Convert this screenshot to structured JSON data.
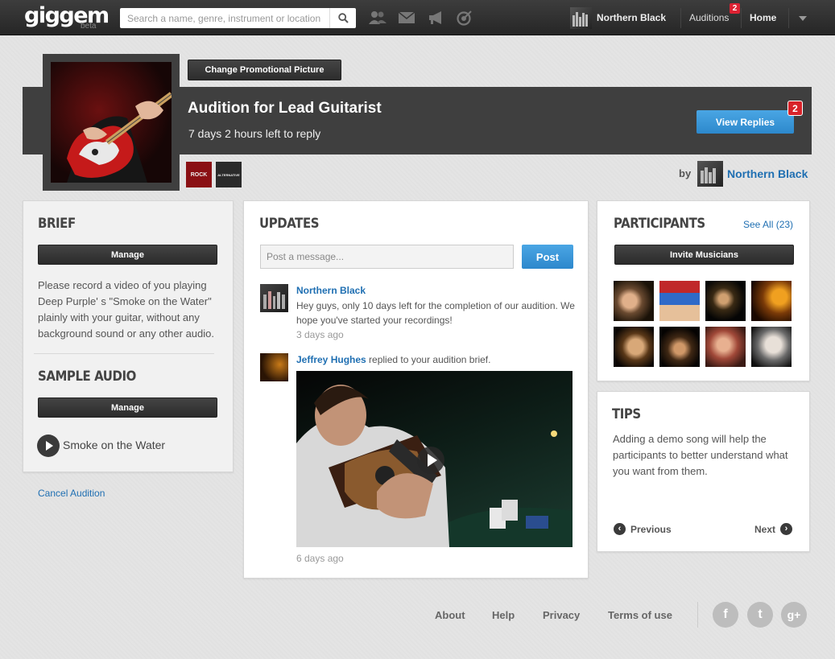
{
  "topbar": {
    "logo": "giggem",
    "logo_tag": "beta",
    "search_placeholder": "Search a name, genre, instrument or location",
    "nav_icons": [
      "people-icon",
      "mail-icon",
      "megaphone-icon",
      "target-icon"
    ],
    "user_name": "Northern Black",
    "auditions_label": "Auditions",
    "auditions_badge": "2",
    "home_label": "Home"
  },
  "header": {
    "change_picture_label": "Change Promotional Picture",
    "title": "Audition for Lead Guitarist",
    "time_left": "7 days 2 hours left to reply",
    "view_replies_label": "View Replies",
    "replies_badge": "2",
    "genres": [
      {
        "label": "ROCK",
        "color": "#8a1014"
      },
      {
        "label": "ALTERNATIVE",
        "color": "#2a2a2a"
      }
    ],
    "by_label": "by",
    "owner_name": "Northern Black"
  },
  "brief": {
    "heading": "BRIEF",
    "manage_label": "Manage",
    "text": "Please record a video of you playing Deep Purple' s \"Smoke on the Water\" plainly with your guitar, without any background sound or any other audio.",
    "sample_heading": "SAMPLE AUDIO",
    "sample_manage_label": "Manage",
    "track_name": "Smoke on the Water",
    "cancel_label": "Cancel Audition"
  },
  "updates": {
    "heading": "UPDATES",
    "message_placeholder": "Post a message...",
    "post_label": "Post",
    "items": [
      {
        "author": "Northern Black",
        "text": "Hey guys, only 10 days left for the completion of our audition. We hope you've started your recordings!",
        "time": "3 days ago"
      },
      {
        "author": "Jeffrey Hughes",
        "text": " replied to your audition brief.",
        "time": "6 days ago"
      }
    ]
  },
  "participants": {
    "heading": "PARTICIPANTS",
    "see_all_label": "See All (23)",
    "invite_label": "Invite Musicians"
  },
  "tips": {
    "heading": "TIPS",
    "text": "Adding a demo song will help the participants to better understand what you want from them.",
    "prev_label": "Previous",
    "next_label": "Next"
  },
  "footer": {
    "links": [
      "About",
      "Help",
      "Privacy",
      "Terms of use"
    ],
    "social": [
      {
        "name": "facebook-icon",
        "glyph": "f"
      },
      {
        "name": "twitter-icon",
        "glyph": "t"
      },
      {
        "name": "google-plus-icon",
        "glyph": "g+"
      }
    ]
  },
  "colors": {
    "accent_blue": "#2d88cc",
    "link_blue": "#1f6fb2",
    "badge_red": "#d8232a",
    "band_dark": "#3f3f3f"
  }
}
